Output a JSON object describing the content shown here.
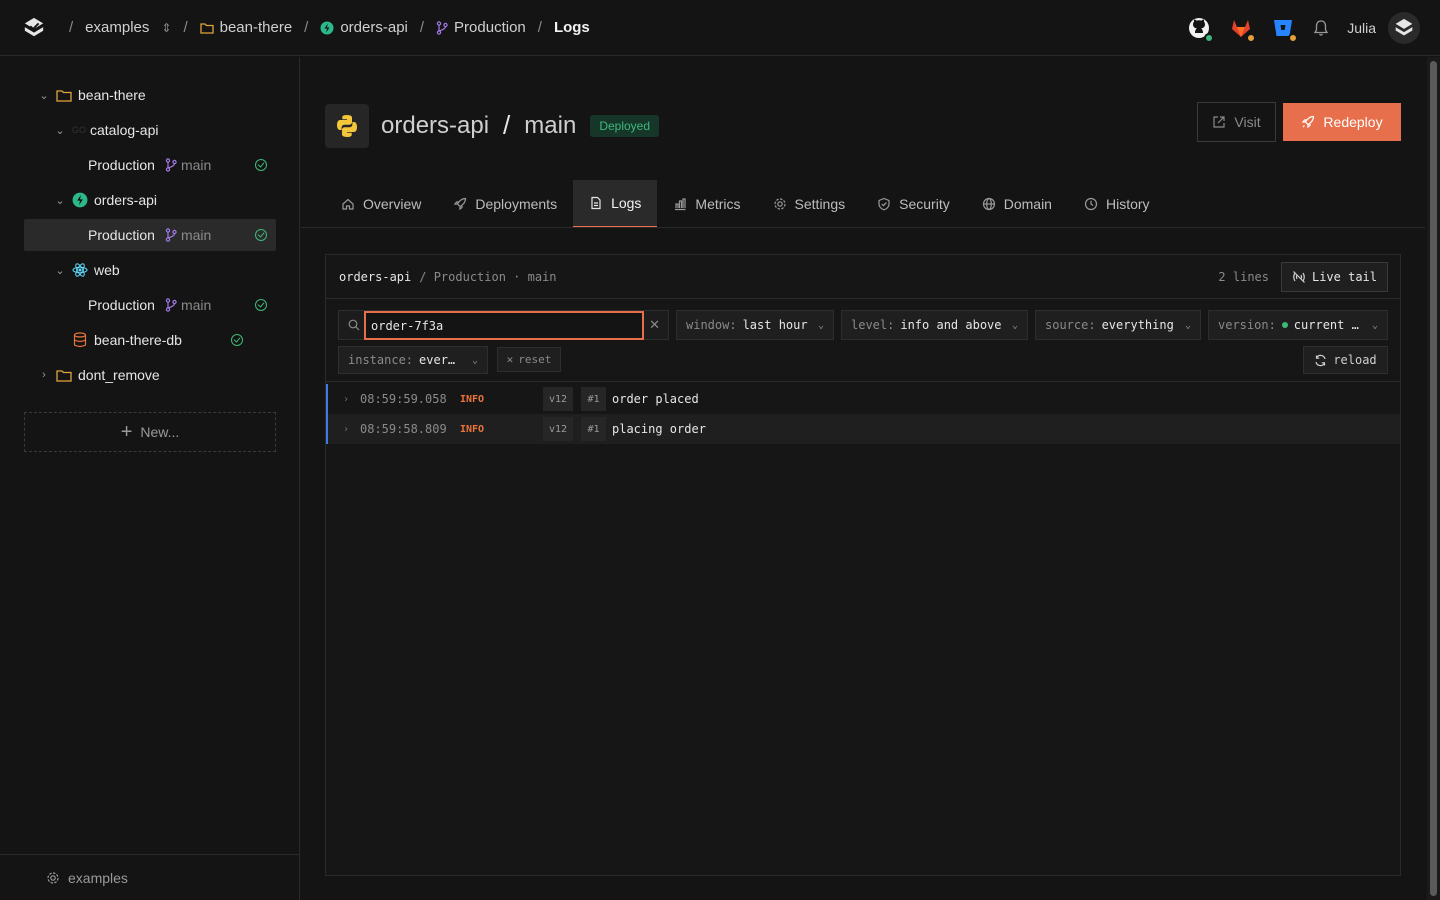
{
  "topbar": {
    "breadcrumbs": [
      "examples",
      "bean-there",
      "orders-api",
      "Production",
      "Logs"
    ],
    "user_name": "Julia"
  },
  "sidebar": {
    "tree": {
      "org": "bean-there",
      "catalog_api": "catalog-api",
      "catalog_env": "Production",
      "catalog_branch": "main",
      "orders_api": "orders-api",
      "orders_env": "Production",
      "orders_branch": "main",
      "web": "web",
      "web_env": "Production",
      "web_branch": "main",
      "db": "bean-there-db",
      "dont_remove": "dont_remove"
    },
    "new_label": "New...",
    "footer_label": "examples"
  },
  "header": {
    "service": "orders-api",
    "branch": "main",
    "status": "Deployed",
    "visit_label": "Visit",
    "redeploy_label": "Redeploy"
  },
  "tabs": [
    {
      "label": "Overview",
      "icon": "home-icon"
    },
    {
      "label": "Deployments",
      "icon": "rocket-icon"
    },
    {
      "label": "Logs",
      "icon": "file-icon",
      "active": true
    },
    {
      "label": "Metrics",
      "icon": "bar-chart-icon"
    },
    {
      "label": "Settings",
      "icon": "gear-icon"
    },
    {
      "label": "Security",
      "icon": "shield-icon"
    },
    {
      "label": "Domain",
      "icon": "globe-icon"
    },
    {
      "label": "History",
      "icon": "clock-icon"
    }
  ],
  "logs": {
    "head_service": "orders-api",
    "head_env": "/ Production · main",
    "line_count": "2 lines",
    "live_tail_label": "Live tail",
    "search_value": "order-7f3a",
    "filters": {
      "window_key": "window:",
      "window_val": "last hour",
      "level_key": "level:",
      "level_val": "info and above",
      "source_key": "source:",
      "source_val": "everything",
      "version_key": "version:",
      "version_val": "current …",
      "instance_key": "instance:",
      "instance_val": "ever…"
    },
    "reset_label": "reset",
    "reload_label": "reload",
    "rows": [
      {
        "time": "08:59:59.058",
        "level": "INFO",
        "version": "v12",
        "instance": "#1",
        "message": "order placed"
      },
      {
        "time": "08:59:58.809",
        "level": "INFO",
        "version": "v12",
        "instance": "#1",
        "message": "placing order"
      }
    ]
  },
  "colors": {
    "accent": "#e86f4b",
    "success": "#3fb87a",
    "log_rail": "#3d7de3",
    "info_level": "#e8743b"
  }
}
